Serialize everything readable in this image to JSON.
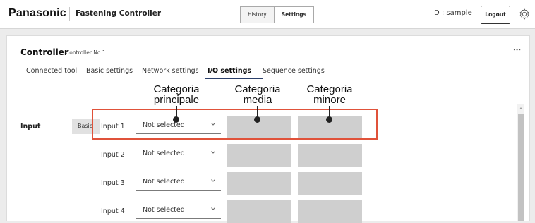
{
  "header": {
    "logo": "Panasonic",
    "app_title": "Fastening Controller",
    "nav": [
      {
        "label": "History"
      },
      {
        "label": "Settings"
      }
    ],
    "user_id": "ID : sample",
    "logout_label": "Logout",
    "settings_icon": "gear-icon"
  },
  "controller": {
    "title": "Controller",
    "subtitle": "Controller No 1",
    "more_label": "⋯"
  },
  "tabs": [
    {
      "label": "Connected tool"
    },
    {
      "label": "Basic settings"
    },
    {
      "label": "Network settings"
    },
    {
      "label": "I/O settings",
      "active": true
    },
    {
      "label": "Sequence settings"
    }
  ],
  "annotations": [
    {
      "text": "Categoria\nprincipale"
    },
    {
      "text": "Categoria\nmedia"
    },
    {
      "text": "Categoria\nminore"
    }
  ],
  "input_section": {
    "label": "Input",
    "badge": "Basic",
    "rows": [
      {
        "label": "Input 1",
        "value": "Not selected"
      },
      {
        "label": "Input 2",
        "value": "Not selected"
      },
      {
        "label": "Input 3",
        "value": "Not selected"
      },
      {
        "label": "Input 4",
        "value": "Not selected"
      }
    ]
  },
  "colors": {
    "highlight": "#e0523a",
    "tab_accent": "#2b3f6a",
    "placeholder_box": "#cfcfcf"
  }
}
